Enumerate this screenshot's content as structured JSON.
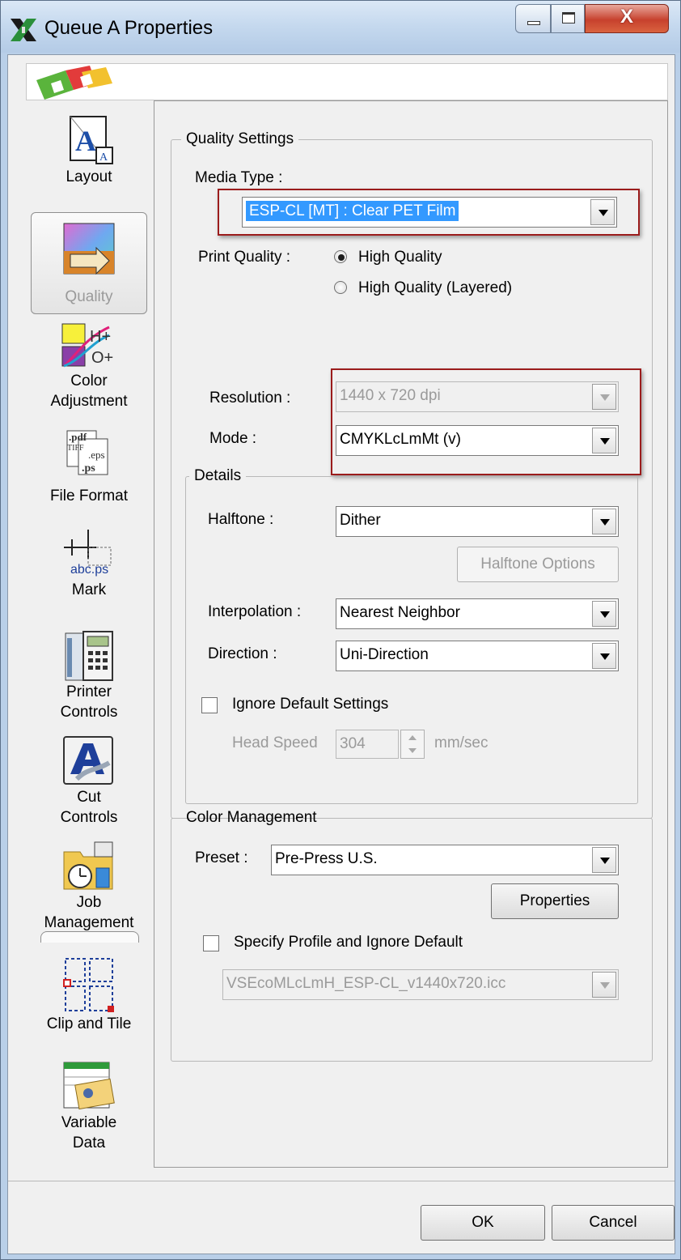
{
  "window": {
    "title": "Queue A Properties",
    "close_glyph": "X"
  },
  "nav": {
    "items": [
      {
        "label": "Layout"
      },
      {
        "label": "Quality"
      },
      {
        "label": "Color Adjustment",
        "line1": "Color",
        "line2": "Adjustment"
      },
      {
        "label": "File Format"
      },
      {
        "label": "Mark"
      },
      {
        "label": "Printer Controls",
        "line1": "Printer",
        "line2": "Controls"
      },
      {
        "label": "Cut Controls",
        "line1": "Cut",
        "line2": "Controls"
      },
      {
        "label": "Job Management",
        "line1": "Job",
        "line2": "Management"
      },
      {
        "label": "Clip and Tile"
      },
      {
        "label": "Variable Data",
        "line1": "Variable",
        "line2": "Data"
      }
    ],
    "selected": "Quality",
    "mark_icon_text": "abc.ps",
    "fileformat_icon_text": {
      "a": ".pdf",
      "b": "TIFF",
      "c": ".eps",
      "d": ".ps"
    }
  },
  "quality": {
    "group_title": "Quality Settings",
    "media_type_label": "Media Type :",
    "media_type_value": "ESP-CL [MT] : Clear PET Film",
    "print_quality_label": "Print Quality :",
    "print_quality_options": [
      "High Quality",
      "High Quality (Layered)"
    ],
    "print_quality_selected": "High Quality",
    "resolution_label": "Resolution :",
    "resolution_value": "1440 x 720 dpi",
    "mode_label": "Mode :",
    "mode_value": "CMYKLcLmMt (v)"
  },
  "details": {
    "group_title": "Details",
    "halftone_label": "Halftone :",
    "halftone_value": "Dither",
    "halftone_options_button": "Halftone Options",
    "interpolation_label": "Interpolation :",
    "interpolation_value": "Nearest Neighbor",
    "direction_label": "Direction :",
    "direction_value": "Uni-Direction",
    "ignore_default_label": "Ignore Default Settings",
    "head_speed_label": "Head Speed",
    "head_speed_value": "304",
    "head_speed_unit": "mm/sec"
  },
  "color_management": {
    "group_title": "Color Management",
    "preset_label": "Preset :",
    "preset_value": "Pre-Press U.S.",
    "properties_button": "Properties",
    "specify_profile_label": "Specify Profile and Ignore Default",
    "profile_value": "VSEcoMLcLmH_ESP-CL_v1440x720.icc"
  },
  "footer": {
    "ok": "OK",
    "cancel": "Cancel"
  },
  "colors": {
    "highlight": "#9b1c1c",
    "selection": "#3399ff"
  }
}
